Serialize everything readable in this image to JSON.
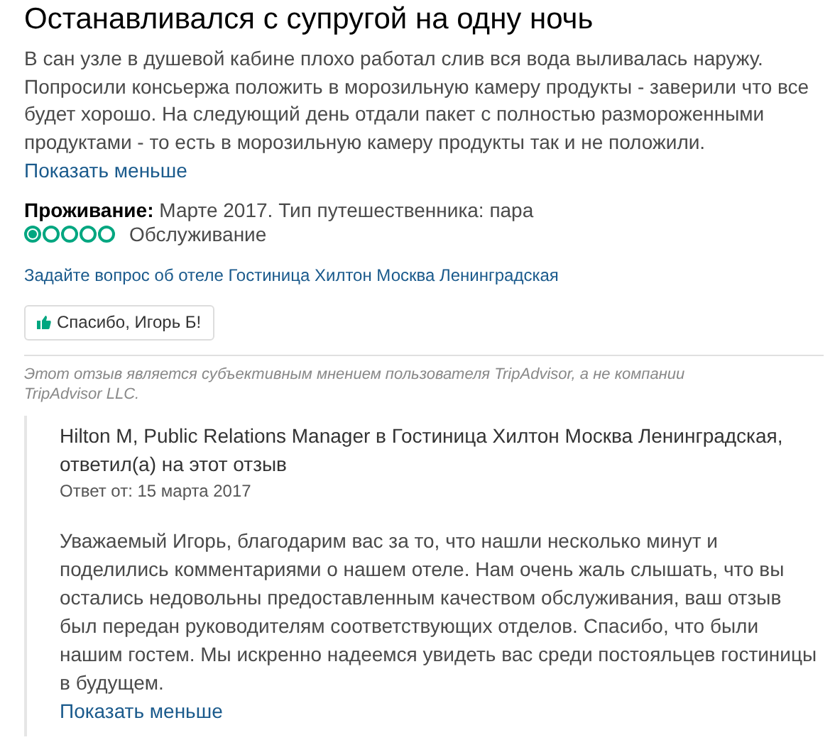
{
  "review": {
    "title": "Останавливался с супругой на одну ночь",
    "text": "В сан узле в душевой кабине плохо работал слив вся вода выливалась наружу. Попросили консьержа положить в морозильную камеру продукты - заверили что все будет хорошо. На следующий день отдали пакет с полностью размороженными продуктами - то есть в морозильную камеру продукты так и не положили.",
    "toggle": "Показать меньше",
    "stay_label": "Проживание:",
    "stay_value": "Марте 2017. Тип путешественника: пара",
    "ratings": [
      {
        "label": "Обслуживание",
        "stars": 1
      }
    ],
    "question_link": "Задайте вопрос об отеле Гостиница Хилтон Москва Ленинградская",
    "thanks_button": "Спасибо, Игорь Б!",
    "disclaimer": "Этот отзыв является субъективным мнением пользователя TripAdvisor, а не компании TripAdvisor LLC."
  },
  "response": {
    "header": "Hilton M, Public Relations Manager в Гостиница Хилтон Москва Ленинградская, ответил(а) на этот отзыв",
    "date": "Ответ от: 15 марта 2017",
    "text": "Уважаемый Игорь, благодарим вас за то, что нашли несколько минут и поделились комментариями о нашем отеле. Нам очень жаль слышать, что вы остались недовольны предоставленным качеством обслуживания, ваш отзыв был передан руководителям соответствующих отделов. Спасибо, что были нашим гостем. Мы искренно надеемся увидеть вас среди постояльцев гостиницы в будущем.",
    "toggle": "Показать меньше"
  }
}
